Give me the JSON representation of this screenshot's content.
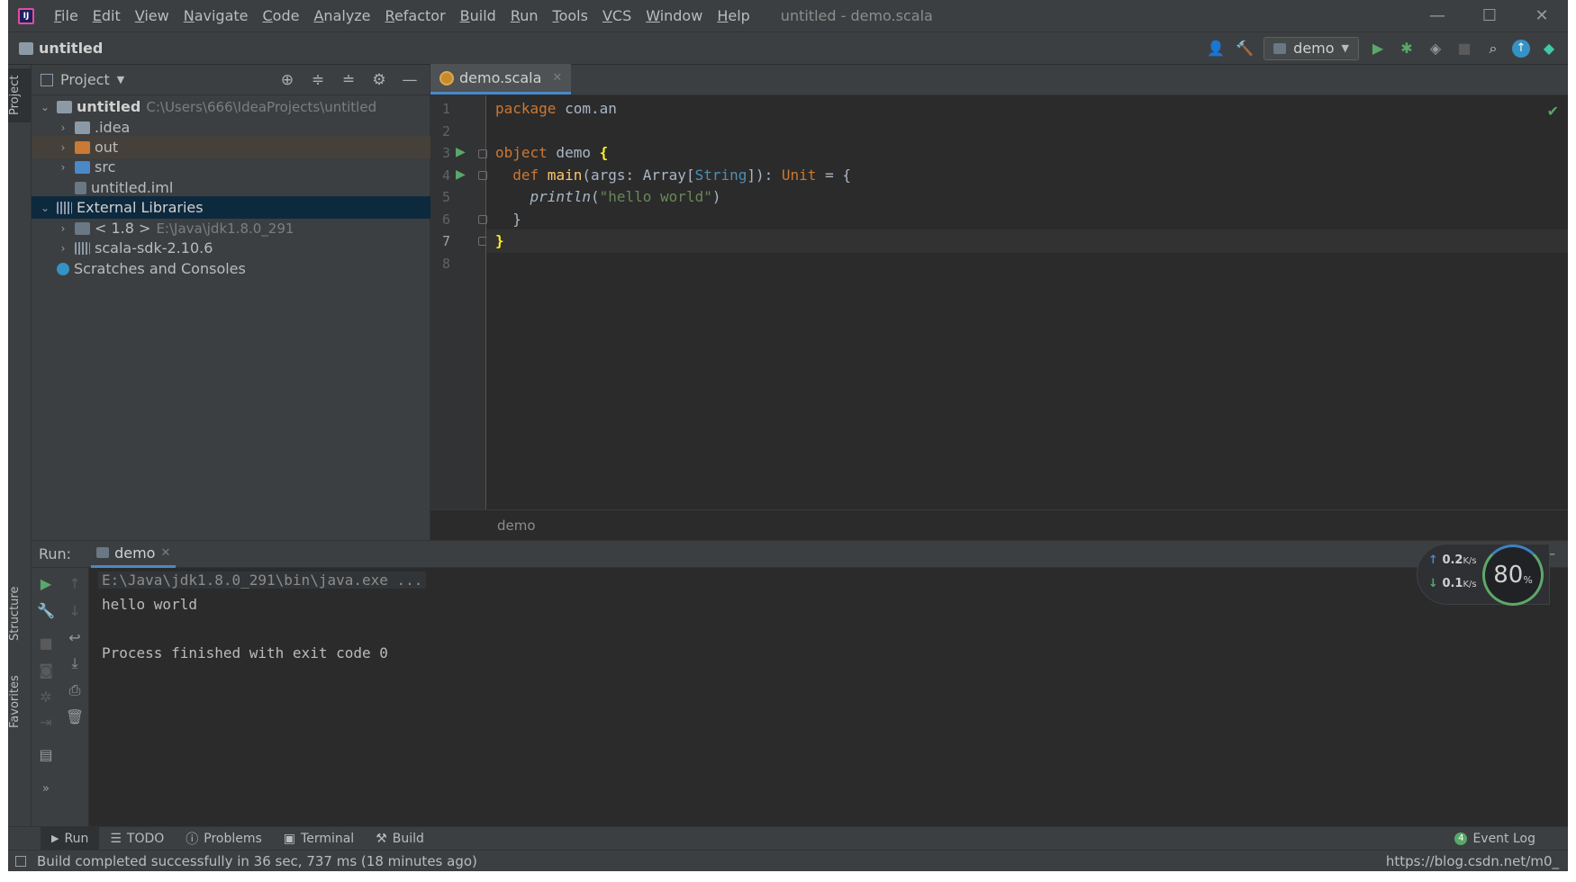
{
  "window": {
    "title": "untitled - demo.scala"
  },
  "menu": [
    "File",
    "Edit",
    "View",
    "Navigate",
    "Code",
    "Analyze",
    "Refactor",
    "Build",
    "Run",
    "Tools",
    "VCS",
    "Window",
    "Help"
  ],
  "navbar": {
    "project_name": "untitled",
    "run_config": "demo"
  },
  "side_tabs": {
    "project": "Project",
    "structure": "Structure",
    "favorites": "Favorites"
  },
  "project_panel": {
    "title": "Project",
    "tree": [
      {
        "label": "untitled",
        "path": "C:\\Users\\666\\IdeaProjects\\untitled"
      },
      {
        "label": ".idea"
      },
      {
        "label": "out"
      },
      {
        "label": "src"
      },
      {
        "label": "untitled.iml"
      },
      {
        "label": "External Libraries"
      },
      {
        "label": "< 1.8 >",
        "path": "E:\\Java\\jdk1.8.0_291"
      },
      {
        "label": "scala-sdk-2.10.6"
      },
      {
        "label": "Scratches and Consoles"
      }
    ]
  },
  "editor": {
    "tab": "demo.scala",
    "line_numbers": [
      "1",
      "2",
      "3",
      "4",
      "5",
      "6",
      "7",
      "8"
    ],
    "code": {
      "l1_kw": "package",
      "l1_rest": " com.an",
      "l3_kw": "object",
      "l3_name": " demo ",
      "l3_brace": "{",
      "l4_kw": "  def",
      "l4_fn": " main",
      "l4_a": "(args: Array[",
      "l4_type": "String",
      "l4_b": "]): ",
      "l4_unit": "Unit",
      "l4_c": " = {",
      "l5_fn": "    println",
      "l5_a": "(",
      "l5_str": "\"hello world\"",
      "l5_b": ")",
      "l6": "  }",
      "l7_brace": "}"
    },
    "breadcrumb": "demo"
  },
  "run_panel": {
    "label": "Run:",
    "tab": "demo",
    "console": [
      "E:\\Java\\jdk1.8.0_291\\bin\\java.exe ...",
      "hello world",
      "",
      "Process finished with exit code 0"
    ]
  },
  "net_widget": {
    "up": "0.2",
    "down": "0.1",
    "unit": "K/s",
    "gauge": "80",
    "gauge_unit": "%"
  },
  "bottom_tools": {
    "run": "Run",
    "todo": "TODO",
    "problems": "Problems",
    "terminal": "Terminal",
    "build": "Build",
    "event_log": "Event Log",
    "event_count": "4"
  },
  "status": {
    "message": "Build completed successfully in 36 sec, 737 ms (18 minutes ago)",
    "right": "https://blog.csdn.net/m0_"
  },
  "colors": {
    "accent": "#4a88c7",
    "run_green": "#59a869",
    "keyword": "#cc7832",
    "string": "#6a8759"
  }
}
